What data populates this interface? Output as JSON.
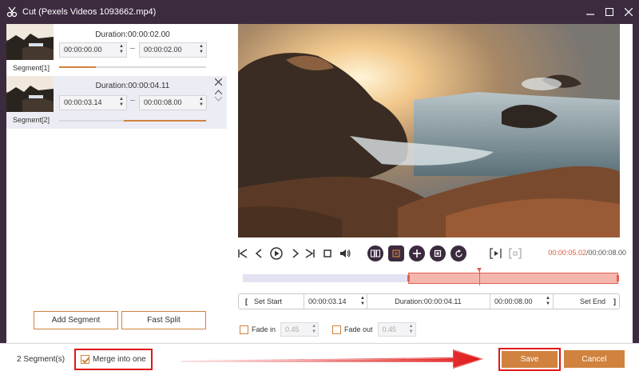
{
  "window": {
    "title": "Cut (Pexels Videos 1093662.mp4)",
    "app_icon": "scissors-icon",
    "controls": {
      "minimize": "minimize-icon",
      "maximize": "maximize-icon",
      "close": "close-icon"
    }
  },
  "segments": [
    {
      "label": "Segment[1]",
      "duration": "Duration:00:00:02.00",
      "start": "00:00:00.00",
      "end": "00:00:02.00",
      "progress_start": 0.0,
      "progress_end": 0.25
    },
    {
      "label": "Segment[2]",
      "duration": "Duration:00:00:04.11",
      "start": "00:00:03.14",
      "end": "00:00:08.00",
      "progress_start": 0.44,
      "progress_end": 1.0
    }
  ],
  "left_buttons": {
    "add_segment": "Add Segment",
    "fast_split": "Fast Split"
  },
  "player": {
    "icons": [
      "skip-start-icon",
      "prev-frame-icon",
      "play-icon",
      "next-frame-icon",
      "skip-end-icon",
      "stop-icon",
      "volume-icon"
    ],
    "edit_icons": [
      "split-icon",
      "copy-icon",
      "add-icon",
      "crop-icon",
      "reset-icon"
    ],
    "mark_icons": [
      "mark-in-icon",
      "mark-out-icon"
    ],
    "current_time": "00:00:05.02",
    "total_time": "/00:00:08.00",
    "selection_start": 0.44,
    "selection_end": 1.0,
    "playhead": 0.63
  },
  "setbar": {
    "set_start": "Set Start",
    "start_value": "00:00:03.14",
    "duration": "Duration:00:00:04.11",
    "end_value": "00:00:08.00",
    "set_end": "Set End"
  },
  "fade": {
    "fade_in_label": "Fade in",
    "fade_in_value": "0.45",
    "fade_out_label": "Fade out",
    "fade_out_value": "0.45"
  },
  "bottom": {
    "segment_count": "2 Segment(s)",
    "merge_label": "Merge into one",
    "merge_checked": true,
    "save": "Save",
    "cancel": "Cancel"
  },
  "colors": {
    "accent": "#d0823e",
    "titlebar": "#3c2b3f",
    "highlight": "#e01818",
    "timeline_selection": "#f4b6ad"
  }
}
